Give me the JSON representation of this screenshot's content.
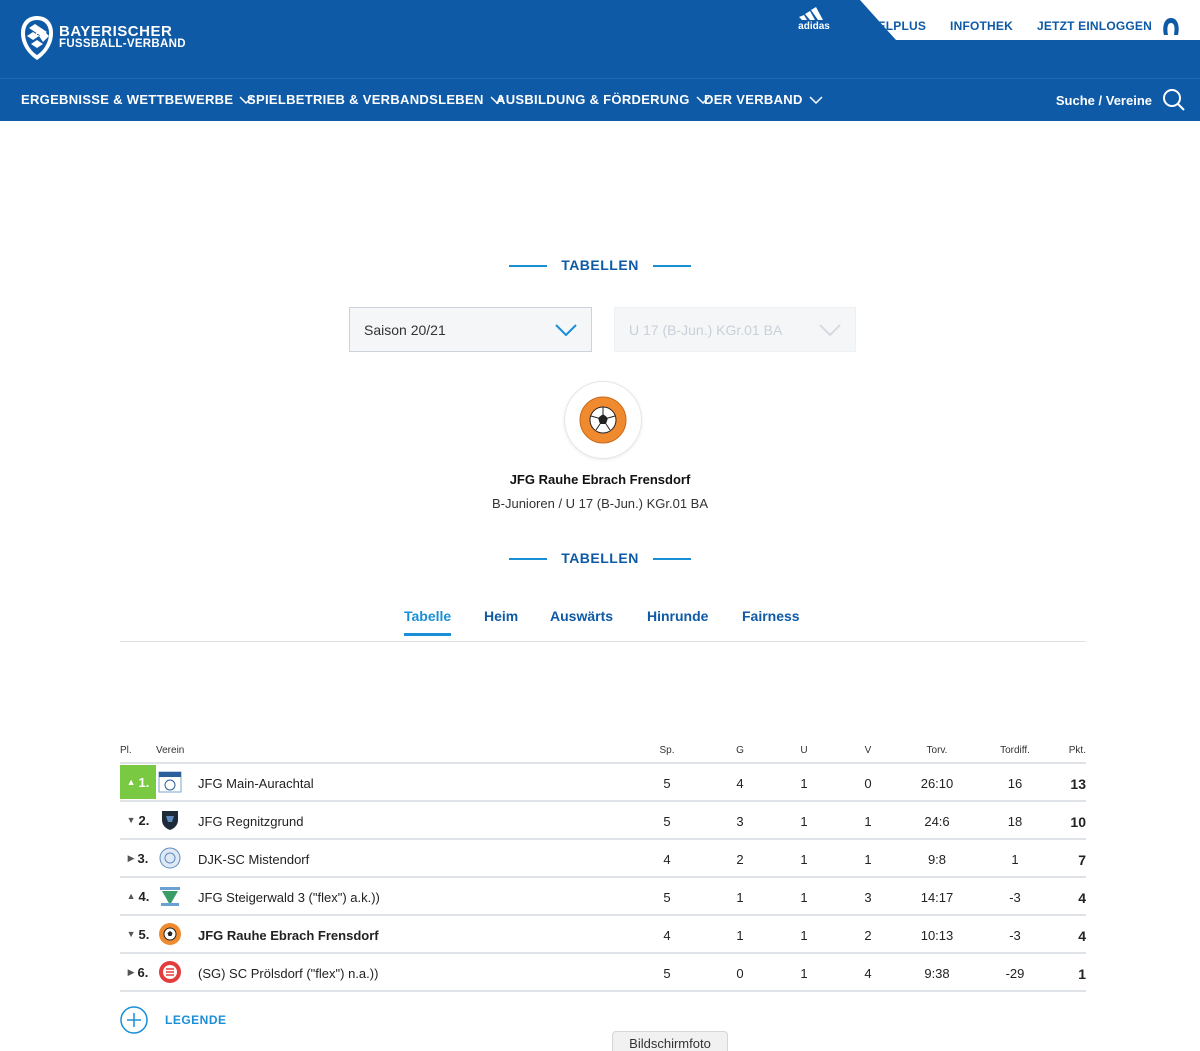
{
  "brand": {
    "line1": "BAYERISCHER",
    "line2": "FUSSBALL-VERBAND",
    "sponsor": "adidas"
  },
  "toplinks": [
    "SPIELPLUS",
    "INFOTHEK",
    "JETZT EINLOGGEN"
  ],
  "nav": {
    "items": [
      "ERGEBNISSE & WETTBEWERBE",
      "SPIELBETRIEB & VERBANDSLEBEN",
      "AUSBILDUNG & FÖRDERUNG",
      "DER VERBAND"
    ],
    "search_label": "Suche / Vereine"
  },
  "heading1": "TABELLEN",
  "heading2": "TABELLEN",
  "selects": {
    "season": "Saison 20/21",
    "league": "U 17 (B-Jun.) KGr.01 BA"
  },
  "team": {
    "name": "JFG Rauhe Ebrach Frensdorf",
    "league": "B-Junioren / U 17 (B-Jun.) KGr.01 BA"
  },
  "tabs": [
    "Tabelle",
    "Heim",
    "Auswärts",
    "Hinrunde",
    "Fairness"
  ],
  "table": {
    "headers": {
      "pl": "Pl.",
      "verein": "Verein",
      "sp": "Sp.",
      "g": "G",
      "u": "U",
      "v": "V",
      "torv": "Torv.",
      "tordiff": "Tordiff.",
      "pkt": "Pkt."
    },
    "rows": [
      {
        "pl": "1.",
        "trend": "▲",
        "name": "JFG Main-Aurachtal",
        "sp": "5",
        "g": "4",
        "u": "1",
        "v": "0",
        "torv": "26:10",
        "td": "16",
        "pkt": "13"
      },
      {
        "pl": "2.",
        "trend": "▼",
        "name": "JFG Regnitzgrund",
        "sp": "5",
        "g": "3",
        "u": "1",
        "v": "1",
        "torv": "24:6",
        "td": "18",
        "pkt": "10"
      },
      {
        "pl": "3.",
        "trend": "▶",
        "name": "DJK-SC Mistendorf",
        "sp": "4",
        "g": "2",
        "u": "1",
        "v": "1",
        "torv": "9:8",
        "td": "1",
        "pkt": "7"
      },
      {
        "pl": "4.",
        "trend": "▲",
        "name": "JFG Steigerwald 3 (\"flex\") a.k.))",
        "sp": "5",
        "g": "1",
        "u": "1",
        "v": "3",
        "torv": "14:17",
        "td": "-3",
        "pkt": "4"
      },
      {
        "pl": "5.",
        "trend": "▼",
        "name": "JFG Rauhe Ebrach Frensdorf",
        "sp": "4",
        "g": "1",
        "u": "1",
        "v": "2",
        "torv": "10:13",
        "td": "-3",
        "pkt": "4"
      },
      {
        "pl": "6.",
        "trend": "▶",
        "name": "(SG) SC Prölsdorf (\"flex\") n.a.))",
        "sp": "5",
        "g": "0",
        "u": "1",
        "v": "4",
        "torv": "9:38",
        "td": "-29",
        "pkt": "1"
      }
    ]
  },
  "legend_label": "LEGENDE",
  "tooltip": "Bildschirmfoto",
  "colors": {
    "primary": "#0e5aa7",
    "accent": "#1a8fd8",
    "rank_up": "#7ac943"
  }
}
